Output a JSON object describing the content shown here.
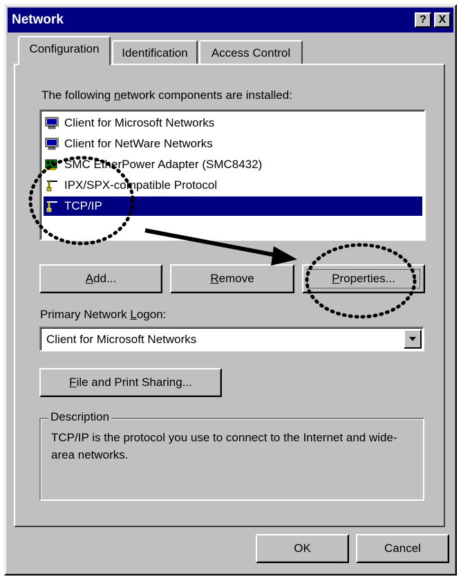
{
  "window": {
    "title": "Network"
  },
  "titlebar": {
    "help_label": "?",
    "close_label": "X"
  },
  "tabs": [
    {
      "label": "Configuration",
      "active": true
    },
    {
      "label": "Identification",
      "active": false
    },
    {
      "label": "Access Control",
      "active": false
    }
  ],
  "components": {
    "label_prefix": "The following ",
    "label_underlined": "n",
    "label_suffix": "etwork components are installed:",
    "items": [
      {
        "label": "Client for Microsoft Networks",
        "icon": "network-client-icon",
        "selected": false
      },
      {
        "label": "Client for NetWare Networks",
        "icon": "network-client-icon",
        "selected": false
      },
      {
        "label": "SMC EtherPower Adapter (SMC8432)",
        "icon": "network-adapter-icon",
        "selected": false
      },
      {
        "label": "IPX/SPX-compatible Protocol",
        "icon": "protocol-icon",
        "selected": false
      },
      {
        "label": "TCP/IP",
        "icon": "protocol-icon",
        "selected": true
      }
    ]
  },
  "buttons": {
    "add_u": "A",
    "add_rest": "dd...",
    "remove_u": "R",
    "remove_rest": "emove",
    "properties_u": "P",
    "properties_rest": "roperties...",
    "file_sharing_u": "F",
    "file_sharing_rest": "ile and Print Sharing...",
    "ok": "OK",
    "cancel": "Cancel"
  },
  "logon": {
    "label_prefix": "Primary Network ",
    "label_underlined": "L",
    "label_suffix": "ogon:",
    "selected": "Client for Microsoft Networks"
  },
  "description": {
    "title": "Description",
    "text": "TCP/IP is the protocol you use to connect to the Internet and wide-area networks."
  },
  "colors": {
    "face": "#c0c0c0",
    "titlebar": "#000080",
    "selection": "#000080"
  }
}
